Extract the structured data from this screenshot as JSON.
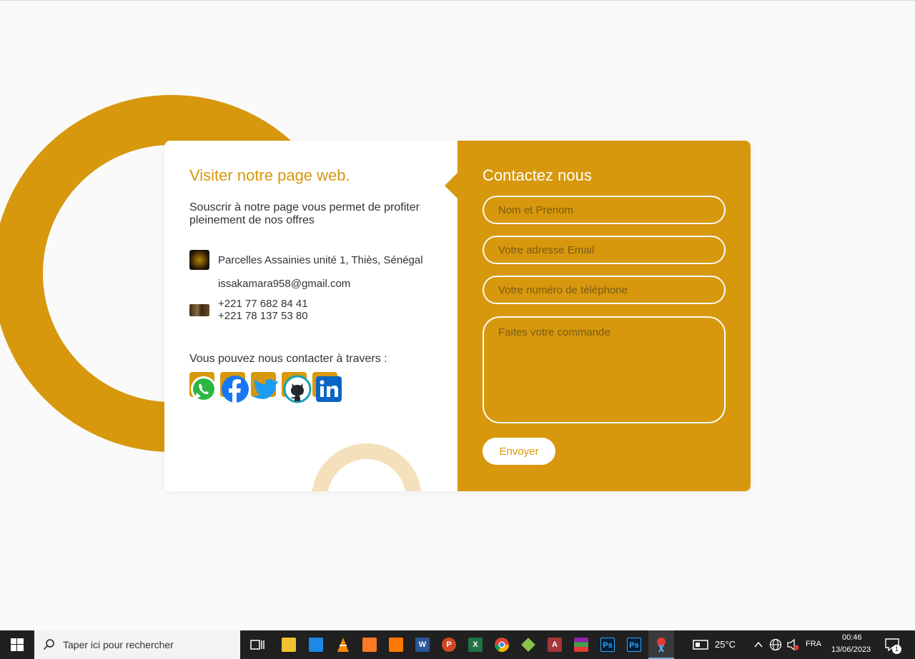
{
  "info": {
    "title": "Visiter notre page web.",
    "text": "Souscrir à notre page vous permet de profiter pleinement de nos offres",
    "address": "Parcelles Assainies unité 1, Thiès, Sénégal",
    "email": "issakamara958@gmail.com",
    "phones": [
      "+221 77 682 84 41",
      "+221 78 137 53 80"
    ],
    "social_label": "Vous pouvez nous contacter à travers :"
  },
  "contact": {
    "title": "Contactez nous",
    "name_placeholder": "Nom et Prenom",
    "email_placeholder": "Votre adresse Email",
    "phone_placeholder": "Votre numéro de téléphone",
    "message_placeholder": "Faites votre commande",
    "submit_label": "Envoyer"
  },
  "taskbar": {
    "search_placeholder": "Taper ici pour rechercher",
    "weather": "25°C",
    "language": "FRA",
    "time": "00:46",
    "date": "13/06/2023",
    "notification_count": "1"
  },
  "colors": {
    "accent": "#d7980d",
    "accent_light": "#f4e0bb",
    "background": "#fafafa"
  }
}
